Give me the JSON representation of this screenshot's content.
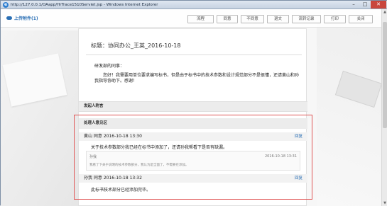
{
  "window": {
    "title": "http://127.0.0.1/OAapp/HrTrace1510Serviet.jsp - Windows Internet Explorer",
    "icon": "ie-icon",
    "minimize": "–",
    "maximize": "□",
    "close": "✕"
  },
  "topbar": {
    "attach_label": "上传附件(1)",
    "buttons": [
      "流程",
      "同意",
      "不同意",
      "退文",
      "流转记录",
      "打印",
      "关闭"
    ]
  },
  "doc": {
    "title": "标题：协同办公_王英_2016-10-18",
    "greeting": "研发部的同事：",
    "body": "您好！我需要用单位要求编写标书，但是由于标书中的技术参数和设计规范部分不是很懂，还请黄山和孙我指导协助下。感谢！",
    "attach_section": "发起人附言",
    "opinion_section": "处理人意见区",
    "opinions": [
      {
        "header": "黄山 同意 2016-10-18 13:30",
        "reply": "回复",
        "text": "关于技术参数部分我已经在标书中添加了，还请孙我帮看下是否有缺漏。"
      },
      {
        "header": "孙我 同意 2016-10-18 13:32",
        "reply": "回复",
        "text": "此标书技术部分已经添加完毕。"
      }
    ],
    "sub_comment": {
      "user": "孙我",
      "time": "2016-10-18 13:31",
      "text": "我看了下关于说明的技术参数部分，我认为是全面了，不需要在添加。"
    }
  }
}
